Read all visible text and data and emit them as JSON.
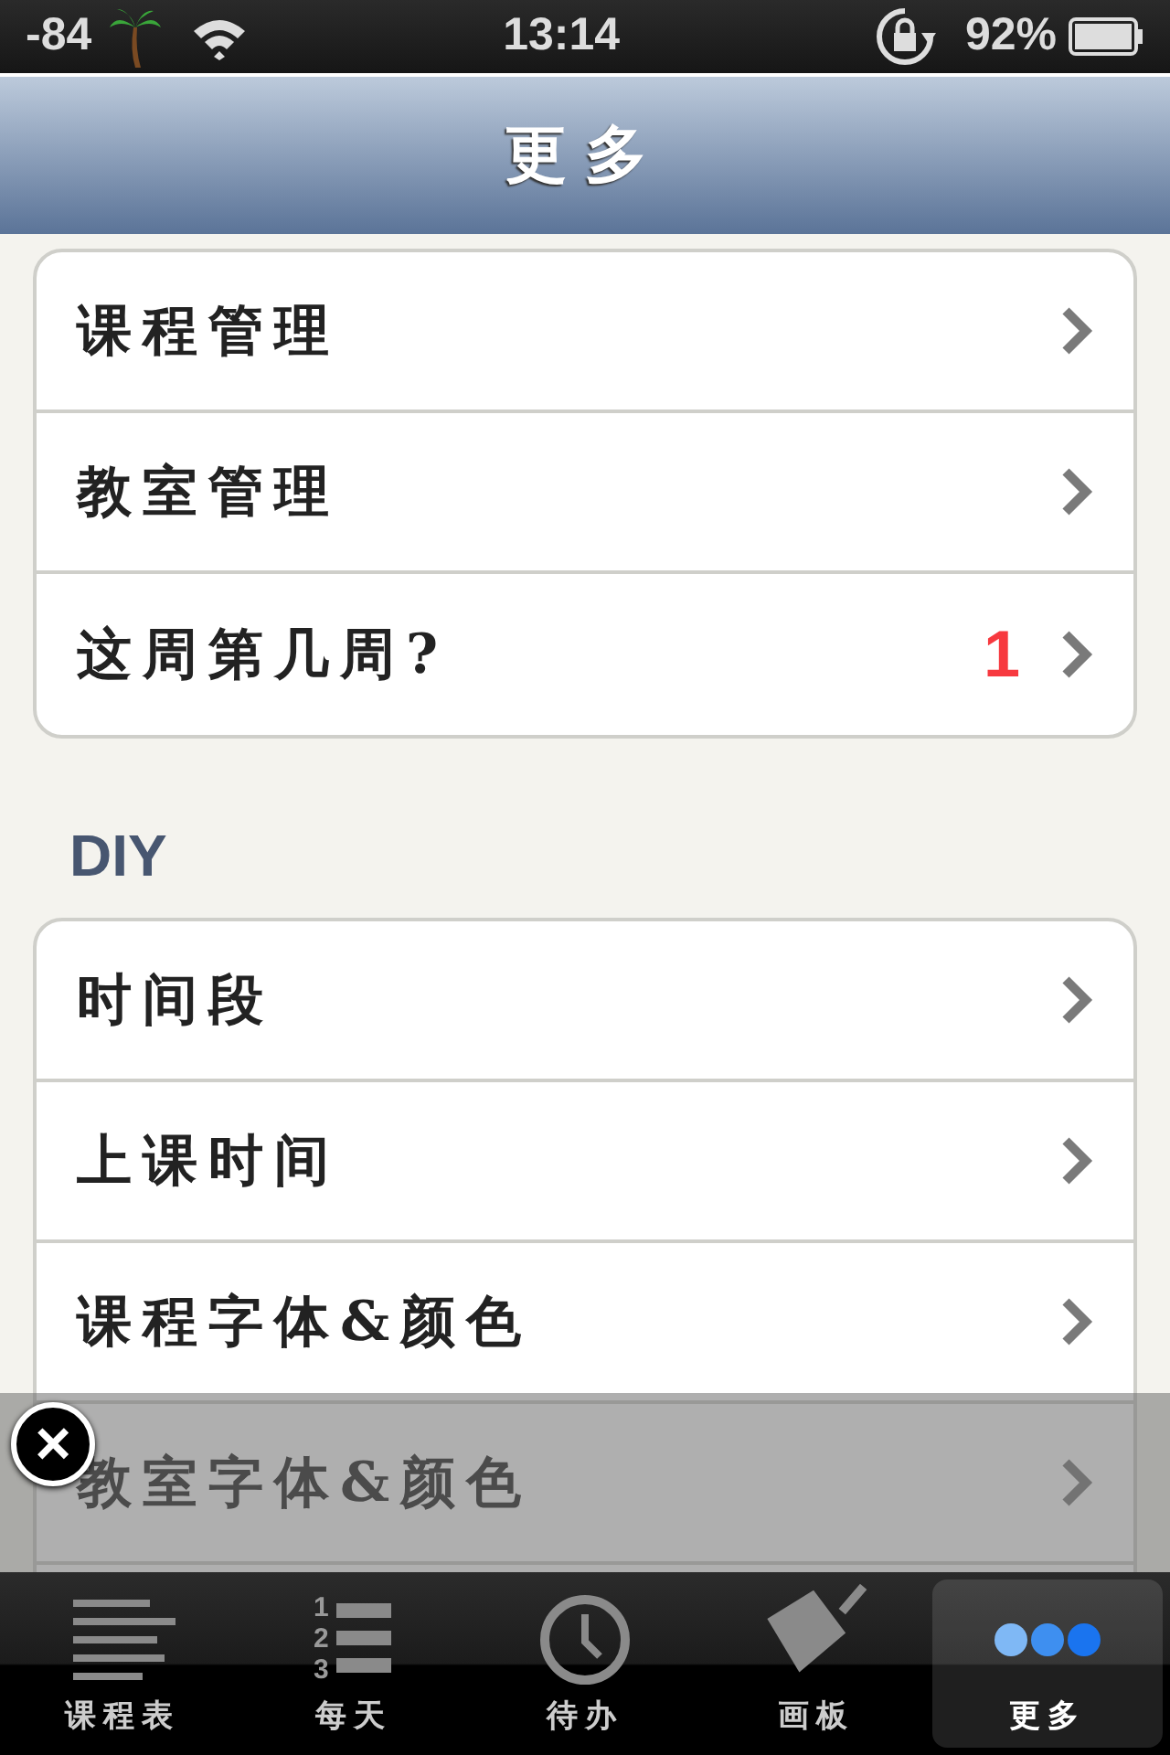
{
  "status_bar": {
    "signal": "-84",
    "time": "13:14",
    "battery": "92%"
  },
  "nav_bar": {
    "title": "更多"
  },
  "groups": [
    {
      "rows": [
        {
          "label": "课程管理"
        },
        {
          "label": "教室管理"
        },
        {
          "label": "这周第几周?",
          "badge": "1"
        }
      ]
    },
    {
      "header": "DIY",
      "rows": [
        {
          "label": "时间段"
        },
        {
          "label": "上课时间"
        },
        {
          "label": "课程字体&颜色"
        },
        {
          "label": "教室字体&颜色"
        }
      ]
    }
  ],
  "ad_overlay": {
    "close": "×"
  },
  "tab_bar": [
    {
      "kind": "lines",
      "label": "课程表",
      "selected": false
    },
    {
      "kind": "numbered",
      "label": "每天",
      "selected": false,
      "numbers": [
        "1",
        "2",
        "3"
      ]
    },
    {
      "kind": "clock",
      "label": "待办",
      "selected": false
    },
    {
      "kind": "board",
      "label": "画板",
      "selected": false
    },
    {
      "kind": "dots",
      "label": "更多",
      "selected": true
    }
  ]
}
